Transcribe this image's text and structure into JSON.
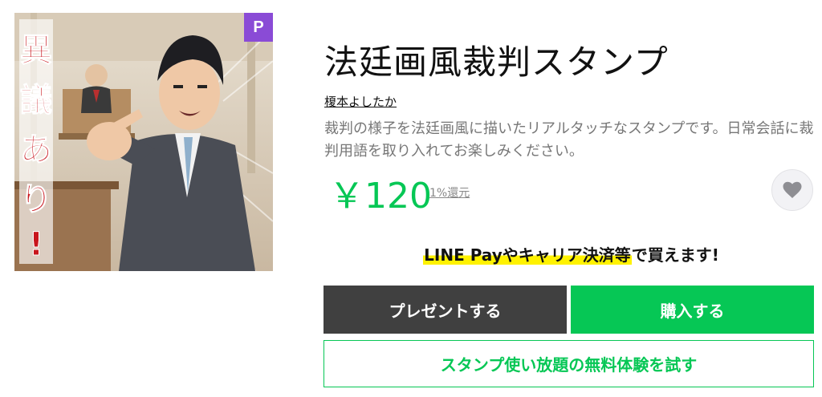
{
  "product": {
    "badge": "P",
    "title": "法廷画風裁判スタンプ",
    "author": "榎本よしたか",
    "description": "裁判の様子を法廷画風に描いたリアルタッチなスタンプです。日常会話に裁判用語を取り入れてお楽しみください。",
    "price": "￥120",
    "points": "1%還元",
    "thumbnail_caption": "異議あり!"
  },
  "promo": {
    "highlight": "LINE Payやキャリア決済等",
    "rest": "で買えます!"
  },
  "actions": {
    "gift_label": "プレゼントする",
    "buy_label": "購入する",
    "trial_label": "スタンプ使い放題の無料体験を試す"
  },
  "colors": {
    "accent": "#06c755",
    "gift_button": "#404040",
    "premium_badge": "#8a4bd6",
    "highlight": "#fff200"
  },
  "icons": {
    "favorite": "heart-icon"
  }
}
